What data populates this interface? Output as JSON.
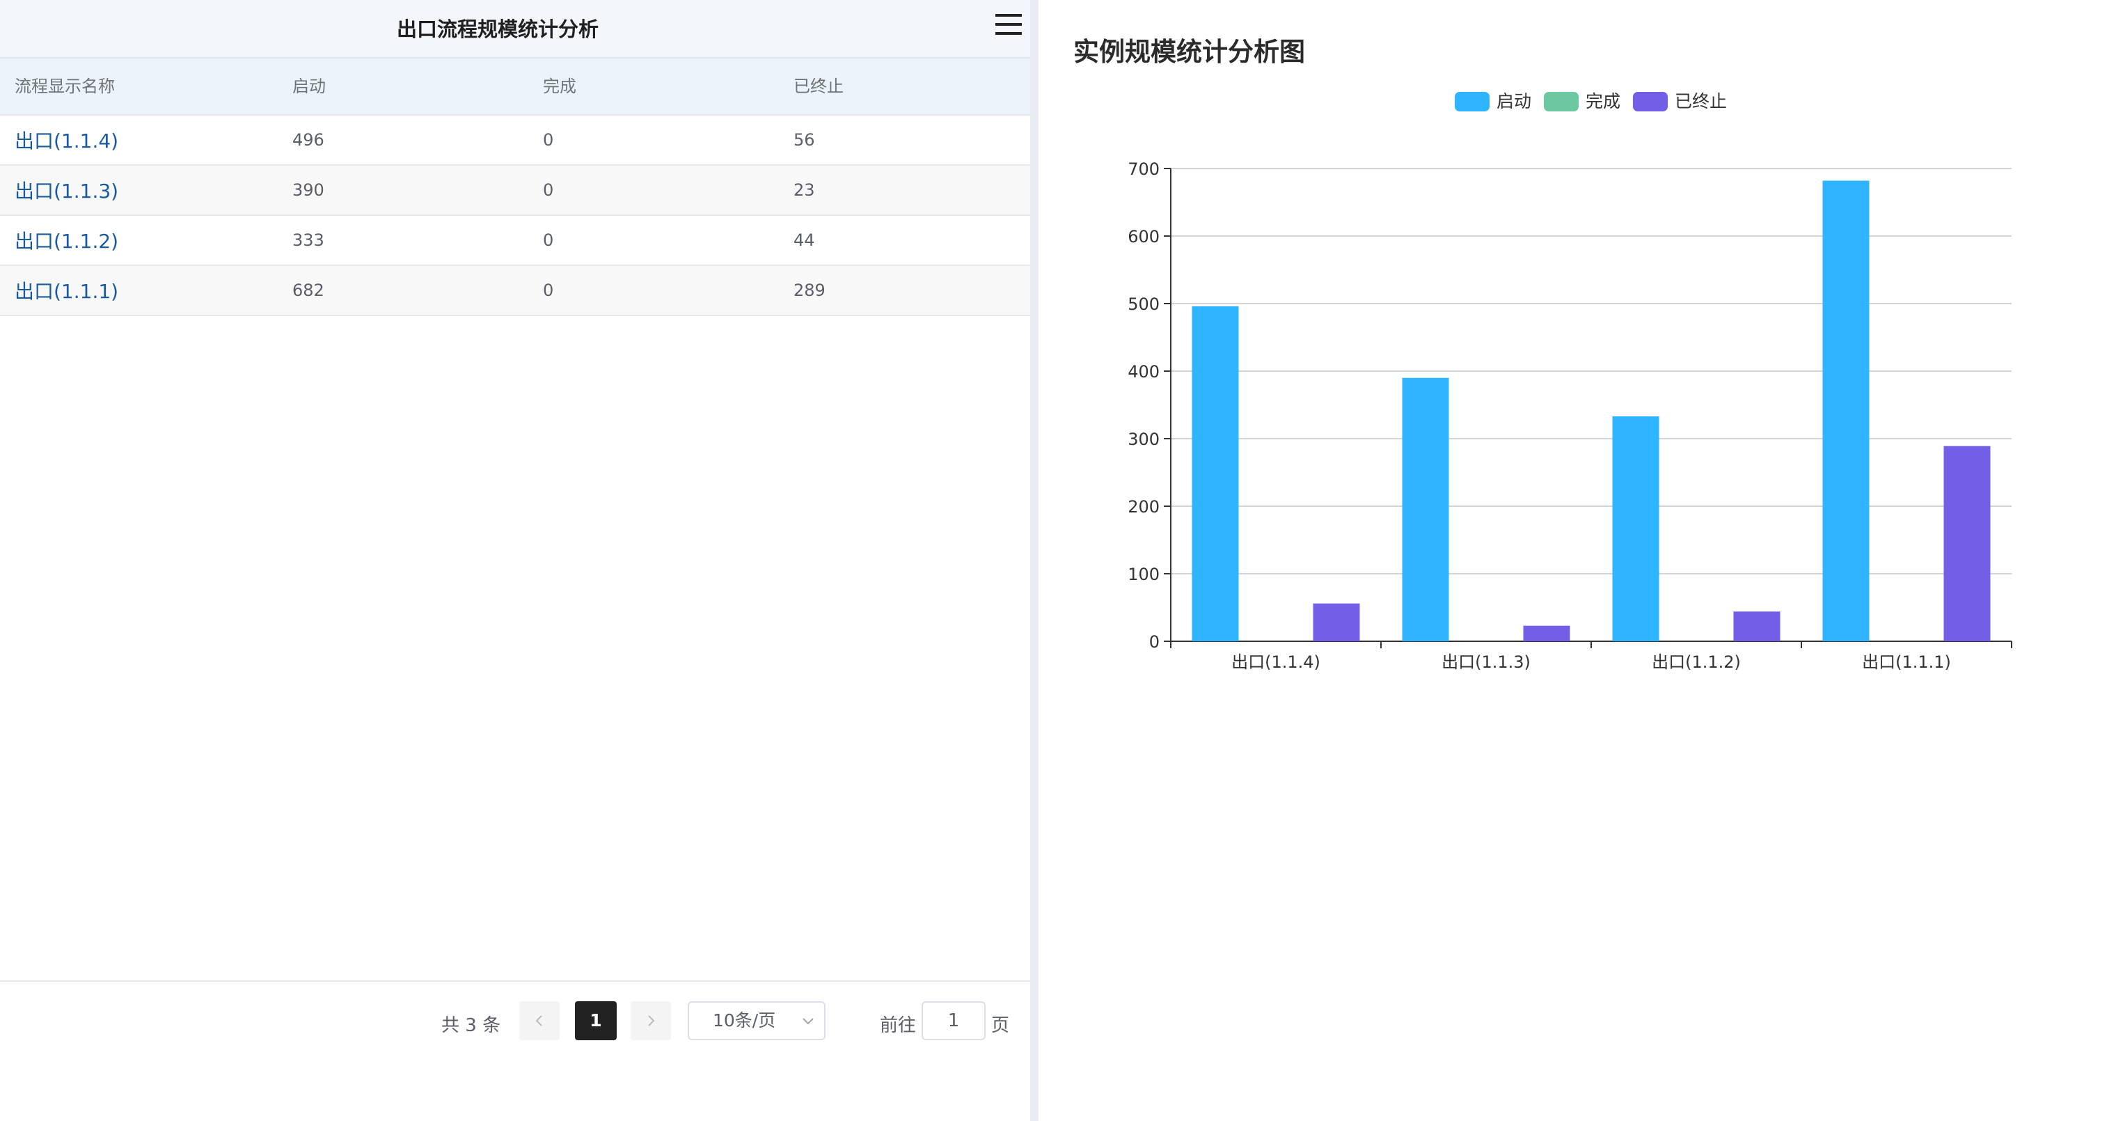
{
  "panel": {
    "title": "出口流程规模统计分析"
  },
  "table": {
    "headers": [
      "流程显示名称",
      "启动",
      "完成",
      "已终止"
    ],
    "rows": [
      {
        "name": "出口(1.1.4)",
        "started": "496",
        "completed": "0",
        "terminated": "56"
      },
      {
        "name": "出口(1.1.3)",
        "started": "390",
        "completed": "0",
        "terminated": "23"
      },
      {
        "name": "出口(1.1.2)",
        "started": "333",
        "completed": "0",
        "terminated": "44"
      },
      {
        "name": "出口(1.1.1)",
        "started": "682",
        "completed": "0",
        "terminated": "289"
      }
    ]
  },
  "pagination": {
    "total_text": "共 3 条",
    "current_page": "1",
    "page_size": "10条/页",
    "goto_prefix": "前往",
    "goto_value": "1",
    "goto_suffix": "页"
  },
  "icons": {
    "menu": "hamburger-menu-icon",
    "prev": "chevron-left-icon",
    "next": "chevron-right-icon",
    "dropdown": "chevron-down-icon"
  },
  "chart_data": {
    "type": "bar",
    "title": "实例规模统计分析图",
    "categories": [
      "出口(1.1.4)",
      "出口(1.1.3)",
      "出口(1.1.2)",
      "出口(1.1.1)"
    ],
    "series": [
      {
        "name": "启动",
        "values": [
          496,
          390,
          333,
          682
        ],
        "color": "#2fb4ff"
      },
      {
        "name": "完成",
        "values": [
          0,
          0,
          0,
          0
        ],
        "color": "#6cc8a1"
      },
      {
        "name": "已终止",
        "values": [
          56,
          23,
          44,
          289
        ],
        "color": "#735ee8"
      }
    ],
    "ylim": [
      0,
      700
    ],
    "yticks": [
      0,
      100,
      200,
      300,
      400,
      500,
      600,
      700
    ],
    "xlabel": "",
    "ylabel": "",
    "grid": true,
    "legend_position": "top-center"
  }
}
